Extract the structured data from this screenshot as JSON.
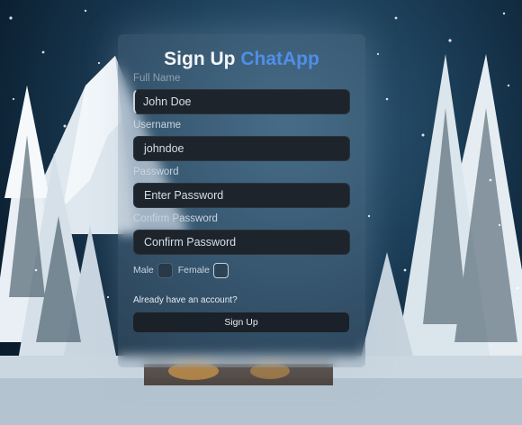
{
  "form": {
    "title": "Sign Up",
    "brand": "ChatApp",
    "fields": [
      {
        "label": "Full Name",
        "value": "John Doe",
        "placeholder": ""
      },
      {
        "label": "Username",
        "value": "johndoe",
        "placeholder": ""
      },
      {
        "label": "Password",
        "value": "",
        "placeholder": "Enter Password"
      },
      {
        "label": "Confirm Password",
        "value": "",
        "placeholder": "Confirm Password"
      }
    ],
    "gender": {
      "male_label": "Male",
      "female_label": "Female",
      "male_checked": false,
      "female_checked": false
    },
    "login_link": "Already have an account?",
    "submit_label": "Sign Up"
  },
  "colors": {
    "brand": "#4f8fe8",
    "input_bg": "#1e242b",
    "button_bg": "#1b2128"
  }
}
